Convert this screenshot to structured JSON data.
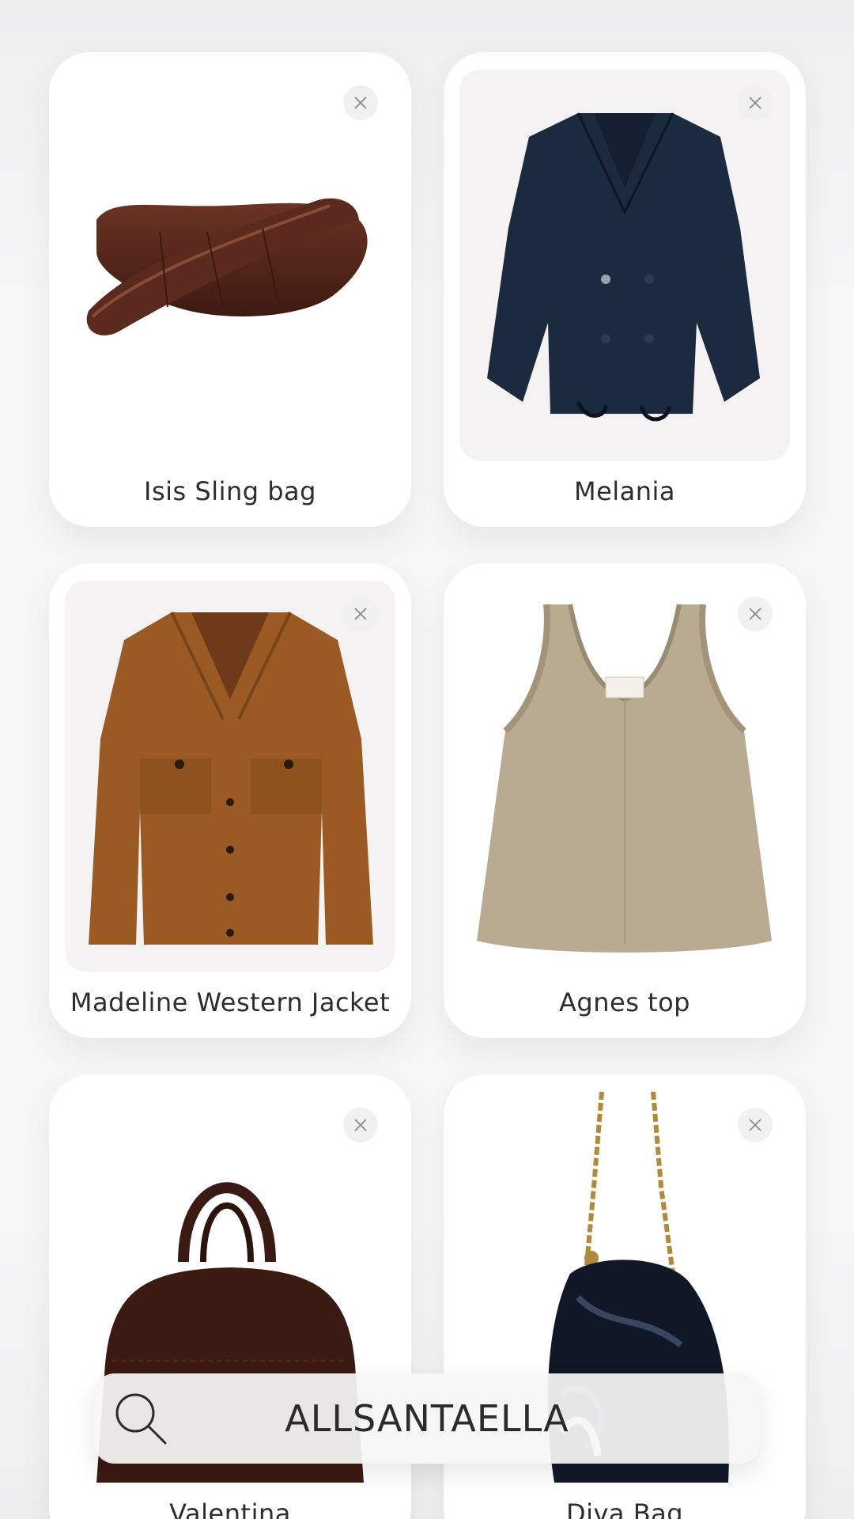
{
  "search_bar": {
    "brand": "ALLSANTAELLA",
    "icon": "search-icon"
  },
  "products": [
    {
      "name": "Isis Sling bag",
      "color": "#5a2a1e"
    },
    {
      "name": "Melania",
      "color": "#1c2a40"
    },
    {
      "name": "Madeline Western Jacket",
      "color": "#9b5a24"
    },
    {
      "name": "Agnes top",
      "color": "#b9ab92"
    },
    {
      "name": "Valentina",
      "color": "#3a1a12"
    },
    {
      "name": "Diva Bag",
      "color": "#101828"
    }
  ],
  "close_icon": "close-icon"
}
